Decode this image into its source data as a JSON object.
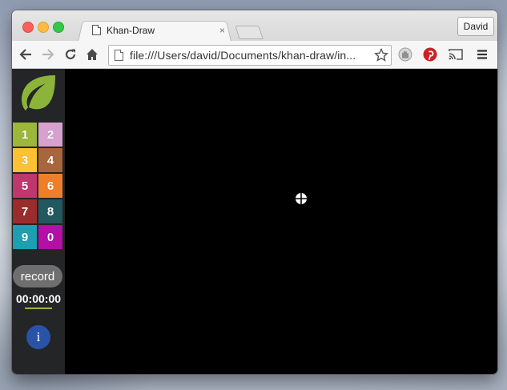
{
  "browser": {
    "tab": {
      "title": "Khan-Draw",
      "close_glyph": "×"
    },
    "profile": {
      "name": "David"
    },
    "address": {
      "url": "file:///Users/david/Documents/khan-draw/in..."
    },
    "toolbar_icons": [
      "back-arrow-icon",
      "forward-arrow-icon",
      "reload-icon",
      "home-icon",
      "bookmark-star-icon",
      "extension-hand-icon",
      "pinterest-icon",
      "cast-icon",
      "menu-icon"
    ]
  },
  "app": {
    "logo": {
      "icon": "leaf-icon",
      "color": "#8cb43a"
    },
    "palette": [
      {
        "key": "1",
        "color": "#9cb73a"
      },
      {
        "key": "2",
        "color": "#d7a1cf"
      },
      {
        "key": "3",
        "color": "#fbc233"
      },
      {
        "key": "4",
        "color": "#a9653b"
      },
      {
        "key": "5",
        "color": "#c0366e"
      },
      {
        "key": "6",
        "color": "#ef7e2a"
      },
      {
        "key": "7",
        "color": "#9a2c2c"
      },
      {
        "key": "8",
        "color": "#22585f"
      },
      {
        "key": "9",
        "color": "#1c9fb0"
      },
      {
        "key": "0",
        "color": "#b40fa6"
      }
    ],
    "record": {
      "label": "record",
      "color": "#6f6f6f"
    },
    "timer": {
      "value": "00:00:00",
      "underline_color": "#9cb73a"
    },
    "info": {
      "label": "i",
      "color": "#2853a8"
    },
    "canvas": {
      "background": "#000000",
      "cursor": "crosshair-cursor-icon"
    }
  }
}
